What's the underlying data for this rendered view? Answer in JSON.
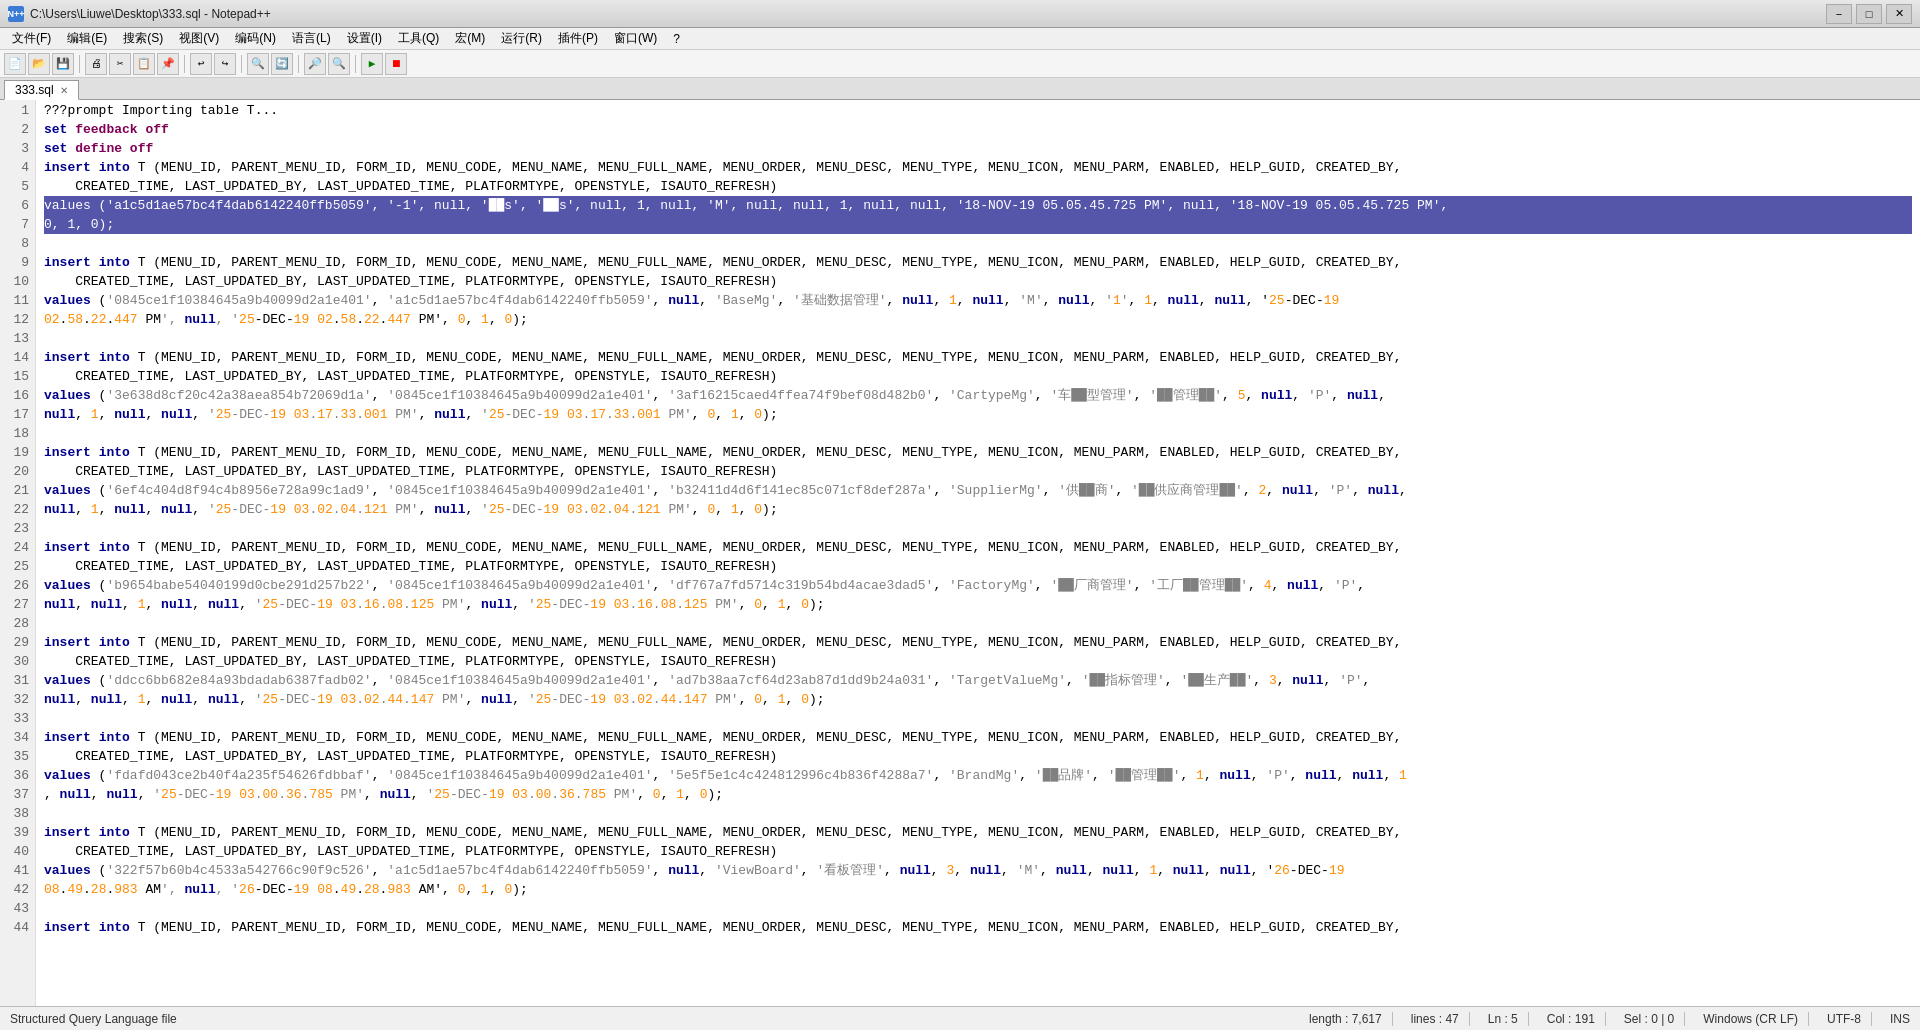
{
  "titleBar": {
    "icon": "N",
    "title": "C:\\Users\\Liuwe\\Desktop\\333.sql - Notepad++",
    "minimize": "−",
    "maximize": "□",
    "close": "✕"
  },
  "menuBar": {
    "items": [
      "文件(F)",
      "编辑(E)",
      "搜索(S)",
      "视图(V)",
      "编码(N)",
      "语言(L)",
      "设置(I)",
      "工具(Q)",
      "宏(M)",
      "运行(R)",
      "插件(P)",
      "窗口(W)",
      "?"
    ]
  },
  "tab": {
    "label": "333.sql",
    "closeBtn": "✕"
  },
  "statusBar": {
    "fileType": "Structured Query Language file",
    "length": "length : 7,617",
    "lines": "lines : 47",
    "ln": "Ln : 5",
    "col": "Col : 191",
    "sel": "Sel : 0 | 0",
    "windows": "Windows (CR LF)",
    "encoding": "UTF-8",
    "ins": "INS"
  },
  "code": {
    "lines": [
      {
        "n": 1,
        "text": "???prompt Importing table T...",
        "selected": false
      },
      {
        "n": 2,
        "text": "set feedback off",
        "selected": false
      },
      {
        "n": 3,
        "text": "set define off",
        "selected": false
      },
      {
        "n": 4,
        "text": "insert into T (MENU_ID, PARENT_MENU_ID, FORM_ID, MENU_CODE, MENU_NAME, MENU_FULL_NAME, MENU_ORDER, MENU_DESC, MENU_TYPE, MENU_ICON, MENU_PARM, ENABLED, HELP_GUID, CREATED_BY,",
        "selected": false
      },
      {
        "n": 5,
        "text": "    CREATED_TIME, LAST_UPDATED_BY, LAST_UPDATED_TIME, PLATFORMTYPE, OPENSTYLE, ISAUTO_REFRESH)",
        "selected": false
      },
      {
        "n": 6,
        "text": "values ('a1c5d1ae57bc4f4dab6142240ffb5059', '-1', null, '██s', '██s', null, 1, null, 'M', null, null, 1, null, null, '18-NOV-19 05.05.45.725 PM', null, '18-NOV-19 05.05.45.725 PM',",
        "selected": true
      },
      {
        "n": 7,
        "text": "0, 1, 0);",
        "selected": true
      },
      {
        "n": 8,
        "text": "",
        "selected": false
      },
      {
        "n": 9,
        "text": "insert into T (MENU_ID, PARENT_MENU_ID, FORM_ID, MENU_CODE, MENU_NAME, MENU_FULL_NAME, MENU_ORDER, MENU_DESC, MENU_TYPE, MENU_ICON, MENU_PARM, ENABLED, HELP_GUID, CREATED_BY,",
        "selected": false
      },
      {
        "n": 10,
        "text": "    CREATED_TIME, LAST_UPDATED_BY, LAST_UPDATED_TIME, PLATFORMTYPE, OPENSTYLE, ISAUTO_REFRESH)",
        "selected": false
      },
      {
        "n": 11,
        "text": "values ('0845ce1f10384645a9b40099d2a1e401', 'a1c5d1ae57bc4f4dab6142240ffb5059', null, 'BaseMg', '基础数据管理', null, 1, null, 'M', null, '1', 1, null, null, '25-DEC-19",
        "selected": false
      },
      {
        "n": 12,
        "text": "02.58.22.447 PM', null, '25-DEC-19 02.58.22.447 PM', 0, 1, 0);",
        "selected": false
      },
      {
        "n": 13,
        "text": "",
        "selected": false
      },
      {
        "n": 14,
        "text": "insert into T (MENU_ID, PARENT_MENU_ID, FORM_ID, MENU_CODE, MENU_NAME, MENU_FULL_NAME, MENU_ORDER, MENU_DESC, MENU_TYPE, MENU_ICON, MENU_PARM, ENABLED, HELP_GUID, CREATED_BY,",
        "selected": false
      },
      {
        "n": 15,
        "text": "    CREATED_TIME, LAST_UPDATED_BY, LAST_UPDATED_TIME, PLATFORMTYPE, OPENSTYLE, ISAUTO_REFRESH)",
        "selected": false
      },
      {
        "n": 16,
        "text": "values ('3e638d8cf20c42a38aea854b72069d1a', '0845ce1f10384645a9b40099d2a1e401', '3af16215caed4ffea74f9bef08d482b0', 'CartypeMg', '车██型管理', '██管理██', 5, null, 'P', null,",
        "selected": false
      },
      {
        "n": 17,
        "text": "null, 1, null, null, '25-DEC-19 03.17.33.001 PM', null, '25-DEC-19 03.17.33.001 PM', 0, 1, 0);",
        "selected": false
      },
      {
        "n": 18,
        "text": "",
        "selected": false
      },
      {
        "n": 19,
        "text": "insert into T (MENU_ID, PARENT_MENU_ID, FORM_ID, MENU_CODE, MENU_NAME, MENU_FULL_NAME, MENU_ORDER, MENU_DESC, MENU_TYPE, MENU_ICON, MENU_PARM, ENABLED, HELP_GUID, CREATED_BY,",
        "selected": false
      },
      {
        "n": 20,
        "text": "    CREATED_TIME, LAST_UPDATED_BY, LAST_UPDATED_TIME, PLATFORMTYPE, OPENSTYLE, ISAUTO_REFRESH)",
        "selected": false
      },
      {
        "n": 21,
        "text": "values ('6ef4c404d8f94c4b8956e728a99c1ad9', '0845ce1f10384645a9b40099d2a1e401', 'b32411d4d6f141ec85c071cf8def287a', 'SupplierMg', '供██商', '██供应商管理██', 2, null, 'P', null,",
        "selected": false
      },
      {
        "n": 22,
        "text": "null, 1, null, null, '25-DEC-19 03.02.04.121 PM', null, '25-DEC-19 03.02.04.121 PM', 0, 1, 0);",
        "selected": false
      },
      {
        "n": 23,
        "text": "",
        "selected": false
      },
      {
        "n": 24,
        "text": "insert into T (MENU_ID, PARENT_MENU_ID, FORM_ID, MENU_CODE, MENU_NAME, MENU_FULL_NAME, MENU_ORDER, MENU_DESC, MENU_TYPE, MENU_ICON, MENU_PARM, ENABLED, HELP_GUID, CREATED_BY,",
        "selected": false
      },
      {
        "n": 25,
        "text": "    CREATED_TIME, LAST_UPDATED_BY, LAST_UPDATED_TIME, PLATFORMTYPE, OPENSTYLE, ISAUTO_REFRESH)",
        "selected": false
      },
      {
        "n": 26,
        "text": "values ('b9654babe54040199d0cbe291d257b22', '0845ce1f10384645a9b40099d2a1e401', 'df767a7fd5714c319b54bd4acae3dad5', 'FactoryMg', '██厂商管理', '工厂██管理██', 4, null, 'P',",
        "selected": false
      },
      {
        "n": 27,
        "text": "null, null, 1, null, null, '25-DEC-19 03.16.08.125 PM', null, '25-DEC-19 03.16.08.125 PM', 0, 1, 0);",
        "selected": false
      },
      {
        "n": 28,
        "text": "",
        "selected": false
      },
      {
        "n": 29,
        "text": "insert into T (MENU_ID, PARENT_MENU_ID, FORM_ID, MENU_CODE, MENU_NAME, MENU_FULL_NAME, MENU_ORDER, MENU_DESC, MENU_TYPE, MENU_ICON, MENU_PARM, ENABLED, HELP_GUID, CREATED_BY,",
        "selected": false
      },
      {
        "n": 30,
        "text": "    CREATED_TIME, LAST_UPDATED_BY, LAST_UPDATED_TIME, PLATFORMTYPE, OPENSTYLE, ISAUTO_REFRESH)",
        "selected": false
      },
      {
        "n": 31,
        "text": "values ('ddcc6bb682e84a93bdadab6387fadb02', '0845ce1f10384645a9b40099d2a1e401', 'ad7b38aa7cf64d23ab87d1dd9b24a031', 'TargetValueMg', '██指标管理', '██生产██', 3, null, 'P',",
        "selected": false
      },
      {
        "n": 32,
        "text": "null, null, 1, null, null, '25-DEC-19 03.02.44.147 PM', null, '25-DEC-19 03.02.44.147 PM', 0, 1, 0);",
        "selected": false
      },
      {
        "n": 33,
        "text": "",
        "selected": false
      },
      {
        "n": 34,
        "text": "insert into T (MENU_ID, PARENT_MENU_ID, FORM_ID, MENU_CODE, MENU_NAME, MENU_FULL_NAME, MENU_ORDER, MENU_DESC, MENU_TYPE, MENU_ICON, MENU_PARM, ENABLED, HELP_GUID, CREATED_BY,",
        "selected": false
      },
      {
        "n": 35,
        "text": "    CREATED_TIME, LAST_UPDATED_BY, LAST_UPDATED_TIME, PLATFORMTYPE, OPENSTYLE, ISAUTO_REFRESH)",
        "selected": false
      },
      {
        "n": 36,
        "text": "values ('fdafd043ce2b40f4a235f54626fdbbaf', '0845ce1f10384645a9b40099d2a1e401', '5e5f5e1c4c424812996c4b836f4288a7', 'BrandMg', '██品牌', '██管理██', 1, null, 'P', null, null, 1",
        "selected": false
      },
      {
        "n": 37,
        "text": ", null, null, '25-DEC-19 03.00.36.785 PM', null, '25-DEC-19 03.00.36.785 PM', 0, 1, 0);",
        "selected": false
      },
      {
        "n": 38,
        "text": "",
        "selected": false
      },
      {
        "n": 39,
        "text": "insert into T (MENU_ID, PARENT_MENU_ID, FORM_ID, MENU_CODE, MENU_NAME, MENU_FULL_NAME, MENU_ORDER, MENU_DESC, MENU_TYPE, MENU_ICON, MENU_PARM, ENABLED, HELP_GUID, CREATED_BY,",
        "selected": false
      },
      {
        "n": 40,
        "text": "    CREATED_TIME, LAST_UPDATED_BY, LAST_UPDATED_TIME, PLATFORMTYPE, OPENSTYLE, ISAUTO_REFRESH)",
        "selected": false
      },
      {
        "n": 41,
        "text": "values ('322f57b60b4c4533a542766c90f9c526', 'a1c5d1ae57bc4f4dab6142240ffb5059', null, 'ViewBoard', '看板管理', null, 3, null, 'M', null, null, 1, null, null, '26-DEC-19",
        "selected": false
      },
      {
        "n": 42,
        "text": "08.49.28.983 AM', null, '26-DEC-19 08.49.28.983 AM', 0, 1, 0);",
        "selected": false
      },
      {
        "n": 43,
        "text": "",
        "selected": false
      },
      {
        "n": 44,
        "text": "insert into T (MENU_ID, PARENT_MENU_ID, FORM_ID, MENU_CODE, MENU_NAME, MENU_FULL_NAME, MENU_ORDER, MENU_DESC, MENU_TYPE, MENU_ICON, MENU_PARM, ENABLED, HELP_GUID, CREATED_BY,",
        "selected": false
      }
    ]
  }
}
